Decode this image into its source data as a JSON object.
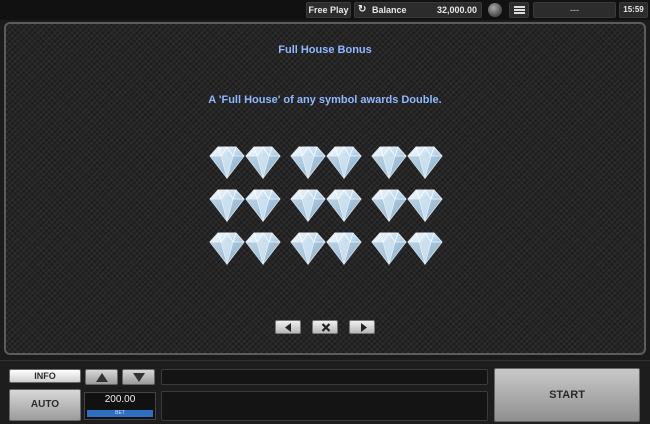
{
  "topbar": {
    "free_play": "Free Play",
    "balance_label": "Balance",
    "balance_value": "32,000.00",
    "status": "---",
    "clock": "15:59"
  },
  "paytable": {
    "title": "Full House Bonus",
    "description": "A 'Full House' of any symbol awards Double.",
    "symbol_icon": "diamond-icon",
    "rows": 3,
    "columns": 6
  },
  "controls": {
    "info_label": "INFO",
    "auto_label": "AUTO",
    "bet_value": "200.00",
    "bet_label": "BET",
    "start_label": "START"
  },
  "colors": {
    "heading": "#8fb8ff",
    "bet_accent": "#2f6fc0"
  }
}
